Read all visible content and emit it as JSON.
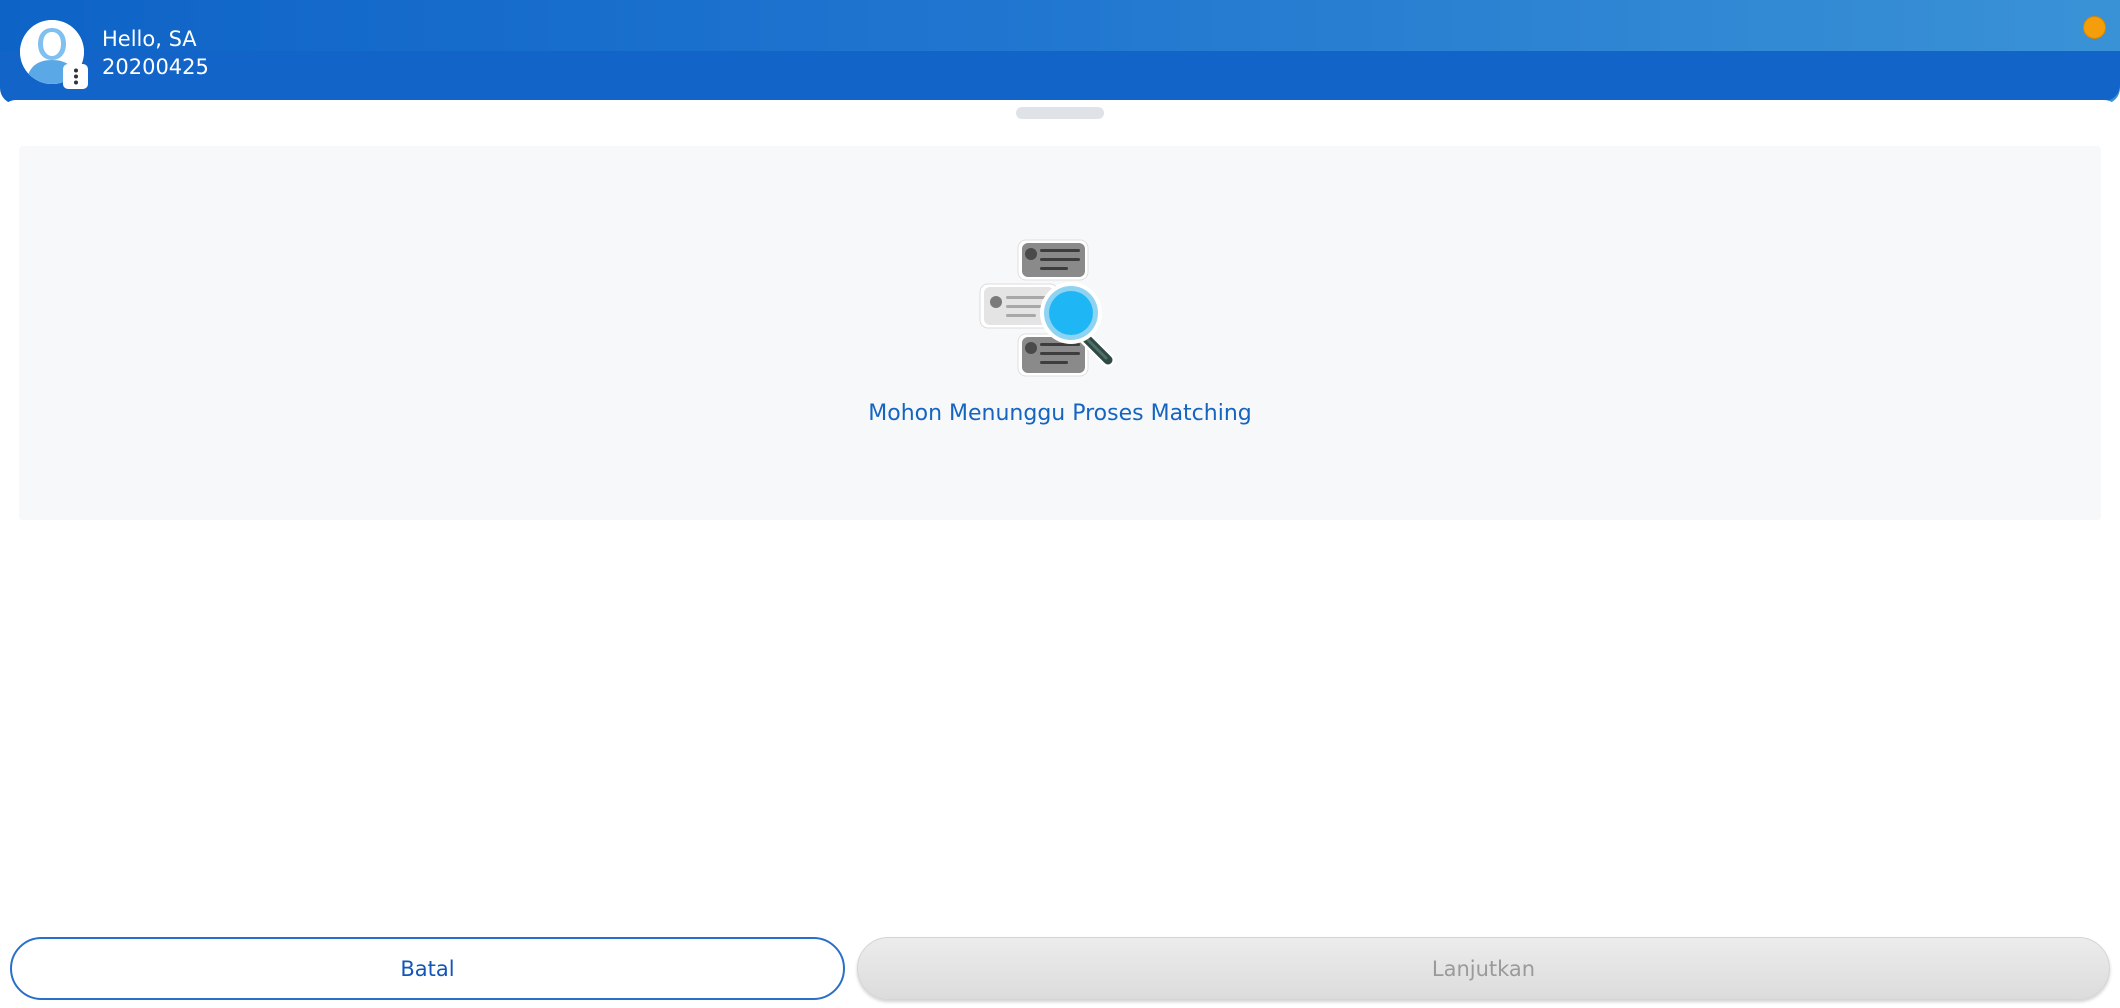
{
  "header": {
    "greeting": "Hello, SA",
    "user_id": "20200425",
    "status_color": "#f59e0b"
  },
  "main": {
    "status_message": "Mohon Menunggu Proses Matching",
    "illustration": "document-search-icon"
  },
  "actions": {
    "cancel_label": "Batal",
    "continue_label": "Lanjutkan",
    "continue_enabled": false
  },
  "colors": {
    "brand_blue": "#1364c9",
    "accent_text": "#1565c0",
    "panel_bg": "#f6f8fa"
  }
}
